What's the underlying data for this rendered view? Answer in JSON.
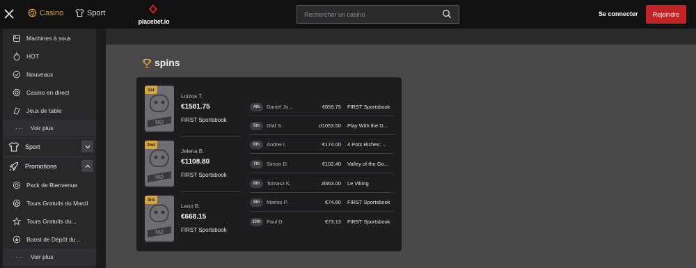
{
  "header": {
    "nav_casino": "Casino",
    "nav_sport": "Sport",
    "logo_text": "placebet.io",
    "search_placeholder": "Rechercher un casino",
    "login_label": "Se connecter",
    "join_label": "Rejoindre"
  },
  "colors": {
    "accent_gold": "#d4a23f",
    "join_red": "#c02424"
  },
  "sidebar": {
    "casino_items": [
      {
        "label": "Machines à sous",
        "icon": "slot-machine-icon"
      },
      {
        "label": "HOT",
        "icon": "flame-icon"
      },
      {
        "label": "Nouveaux",
        "icon": "new-badge-icon"
      },
      {
        "label": "Casino en direct",
        "icon": "live-chip-icon"
      },
      {
        "label": "Jeux de table",
        "icon": "table-games-icon"
      }
    ],
    "casino_more": "Voir plus",
    "sport_label": "Sport",
    "promotions_label": "Promotions",
    "promo_items": [
      {
        "label": "Pack de Bienvenue",
        "icon": "gift-icon"
      },
      {
        "label": "Tours Gratuits du Mardi",
        "icon": "spin-icon"
      },
      {
        "label": "Tours Gratuits du...",
        "icon": "spin-icon"
      },
      {
        "label": "Boost de Dépôt du...",
        "icon": "star-icon"
      }
    ],
    "promo_more": "Voir plus"
  },
  "leaderboard": {
    "title": "spins",
    "podium": [
      {
        "rank": "1st",
        "name": "Loizos T.",
        "amount": "€1581.75",
        "game": "FIRST Sportsbook"
      },
      {
        "rank": "2nd",
        "name": "Jelena B.",
        "amount": "€1108.80",
        "game": "FIRST Sportsbook"
      },
      {
        "rank": "3rd",
        "name": "Leon B.",
        "amount": "€668.15",
        "game": "FIRST Sportsbook"
      }
    ],
    "rows": [
      {
        "rank": "4th",
        "name": "Daniel Jo...",
        "amount": "€659.75",
        "game": "FIRST Sportsbook"
      },
      {
        "rank": "5th",
        "name": "Olaf S.",
        "amount": "zł1053.50",
        "game": "Play With the D..."
      },
      {
        "rank": "6th",
        "name": "Andrei I.",
        "amount": "€174.00",
        "game": "4 Pots Riches: ..."
      },
      {
        "rank": "7th",
        "name": "Simon D.",
        "amount": "€102.40",
        "game": "Valley of the Go..."
      },
      {
        "rank": "8th",
        "name": "Tomasz K.",
        "amount": "zł363.00",
        "game": "Le Viking"
      },
      {
        "rank": "9th",
        "name": "Marios P.",
        "amount": "€74.80",
        "game": "FIRST Sportsbook"
      },
      {
        "rank": "10th",
        "name": "Paul D.",
        "amount": "€73.13",
        "game": "FIRST Sportsbook"
      }
    ]
  }
}
